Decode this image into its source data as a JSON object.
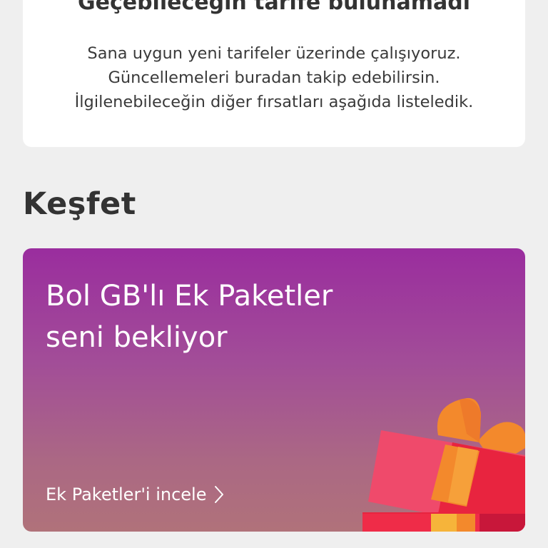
{
  "info_card": {
    "title": "Geçebileceğin tarife bulunamadı",
    "lines": [
      "Sana uygun yeni tarifeler üzerinde çalışıyoruz.",
      "Güncellemeleri buradan takip edebilirsin.",
      "İlgilenebileceğin diğer fırsatları aşağıda listeledik."
    ]
  },
  "section": {
    "title": "Keşfet"
  },
  "promo": {
    "title_lines": [
      "Bol GB'lı Ek Paketler",
      "seni bekliyor"
    ],
    "link_label": "Ek Paketler'i incele",
    "link_icon": "chevron-right-icon",
    "illustration_icon": "gift-box-icon",
    "colors": {
      "gradient_top": "#9a2d9e",
      "gradient_bottom": "#b0727a",
      "gift_red": "#e8243f",
      "gift_pink": "#ef4a6b",
      "gift_orange": "#f3892c",
      "gift_yellow": "#f6b43a"
    }
  },
  "colors": {
    "background": "#efefef",
    "card": "#ffffff",
    "text_dark": "#333333"
  }
}
